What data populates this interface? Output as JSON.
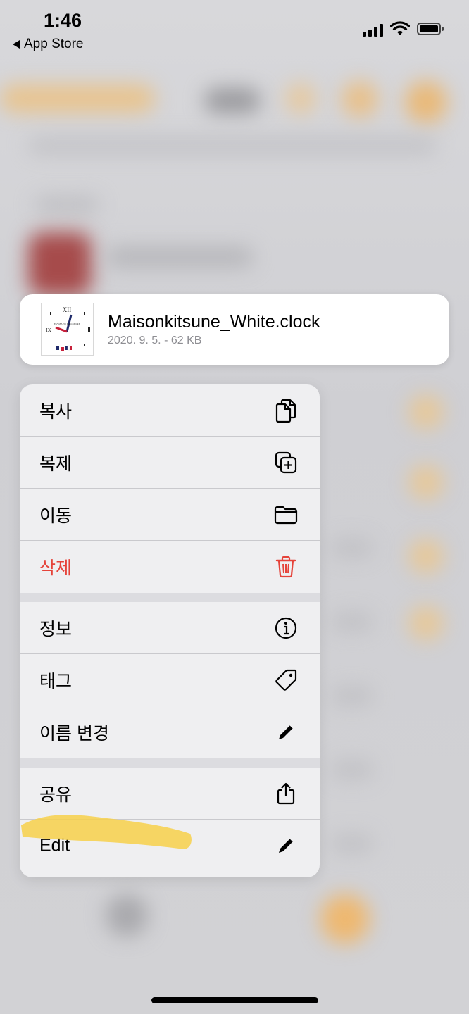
{
  "status_bar": {
    "time": "1:46",
    "back_label": "App Store"
  },
  "preview": {
    "file_name": "Maisonkitsune_White.clock",
    "meta": "2020. 9. 5. - 62 KB",
    "thumbnail_text": "MAISON KITSUNE"
  },
  "menu": {
    "items": [
      {
        "label": "복사",
        "icon": "copy-icon"
      },
      {
        "label": "복제",
        "icon": "duplicate-icon"
      },
      {
        "label": "이동",
        "icon": "folder-icon"
      },
      {
        "label": "삭제",
        "icon": "trash-icon",
        "color": "#e5433a"
      },
      {
        "label": "정보",
        "icon": "info-icon"
      },
      {
        "label": "태그",
        "icon": "tag-icon"
      },
      {
        "label": "이름 변경",
        "icon": "pencil-icon"
      },
      {
        "label": "공유",
        "icon": "share-icon"
      },
      {
        "label": "Edit",
        "icon": "pencil-icon"
      }
    ]
  },
  "colors": {
    "destructive": "#e5433a",
    "highlight": "#f7d04a"
  }
}
